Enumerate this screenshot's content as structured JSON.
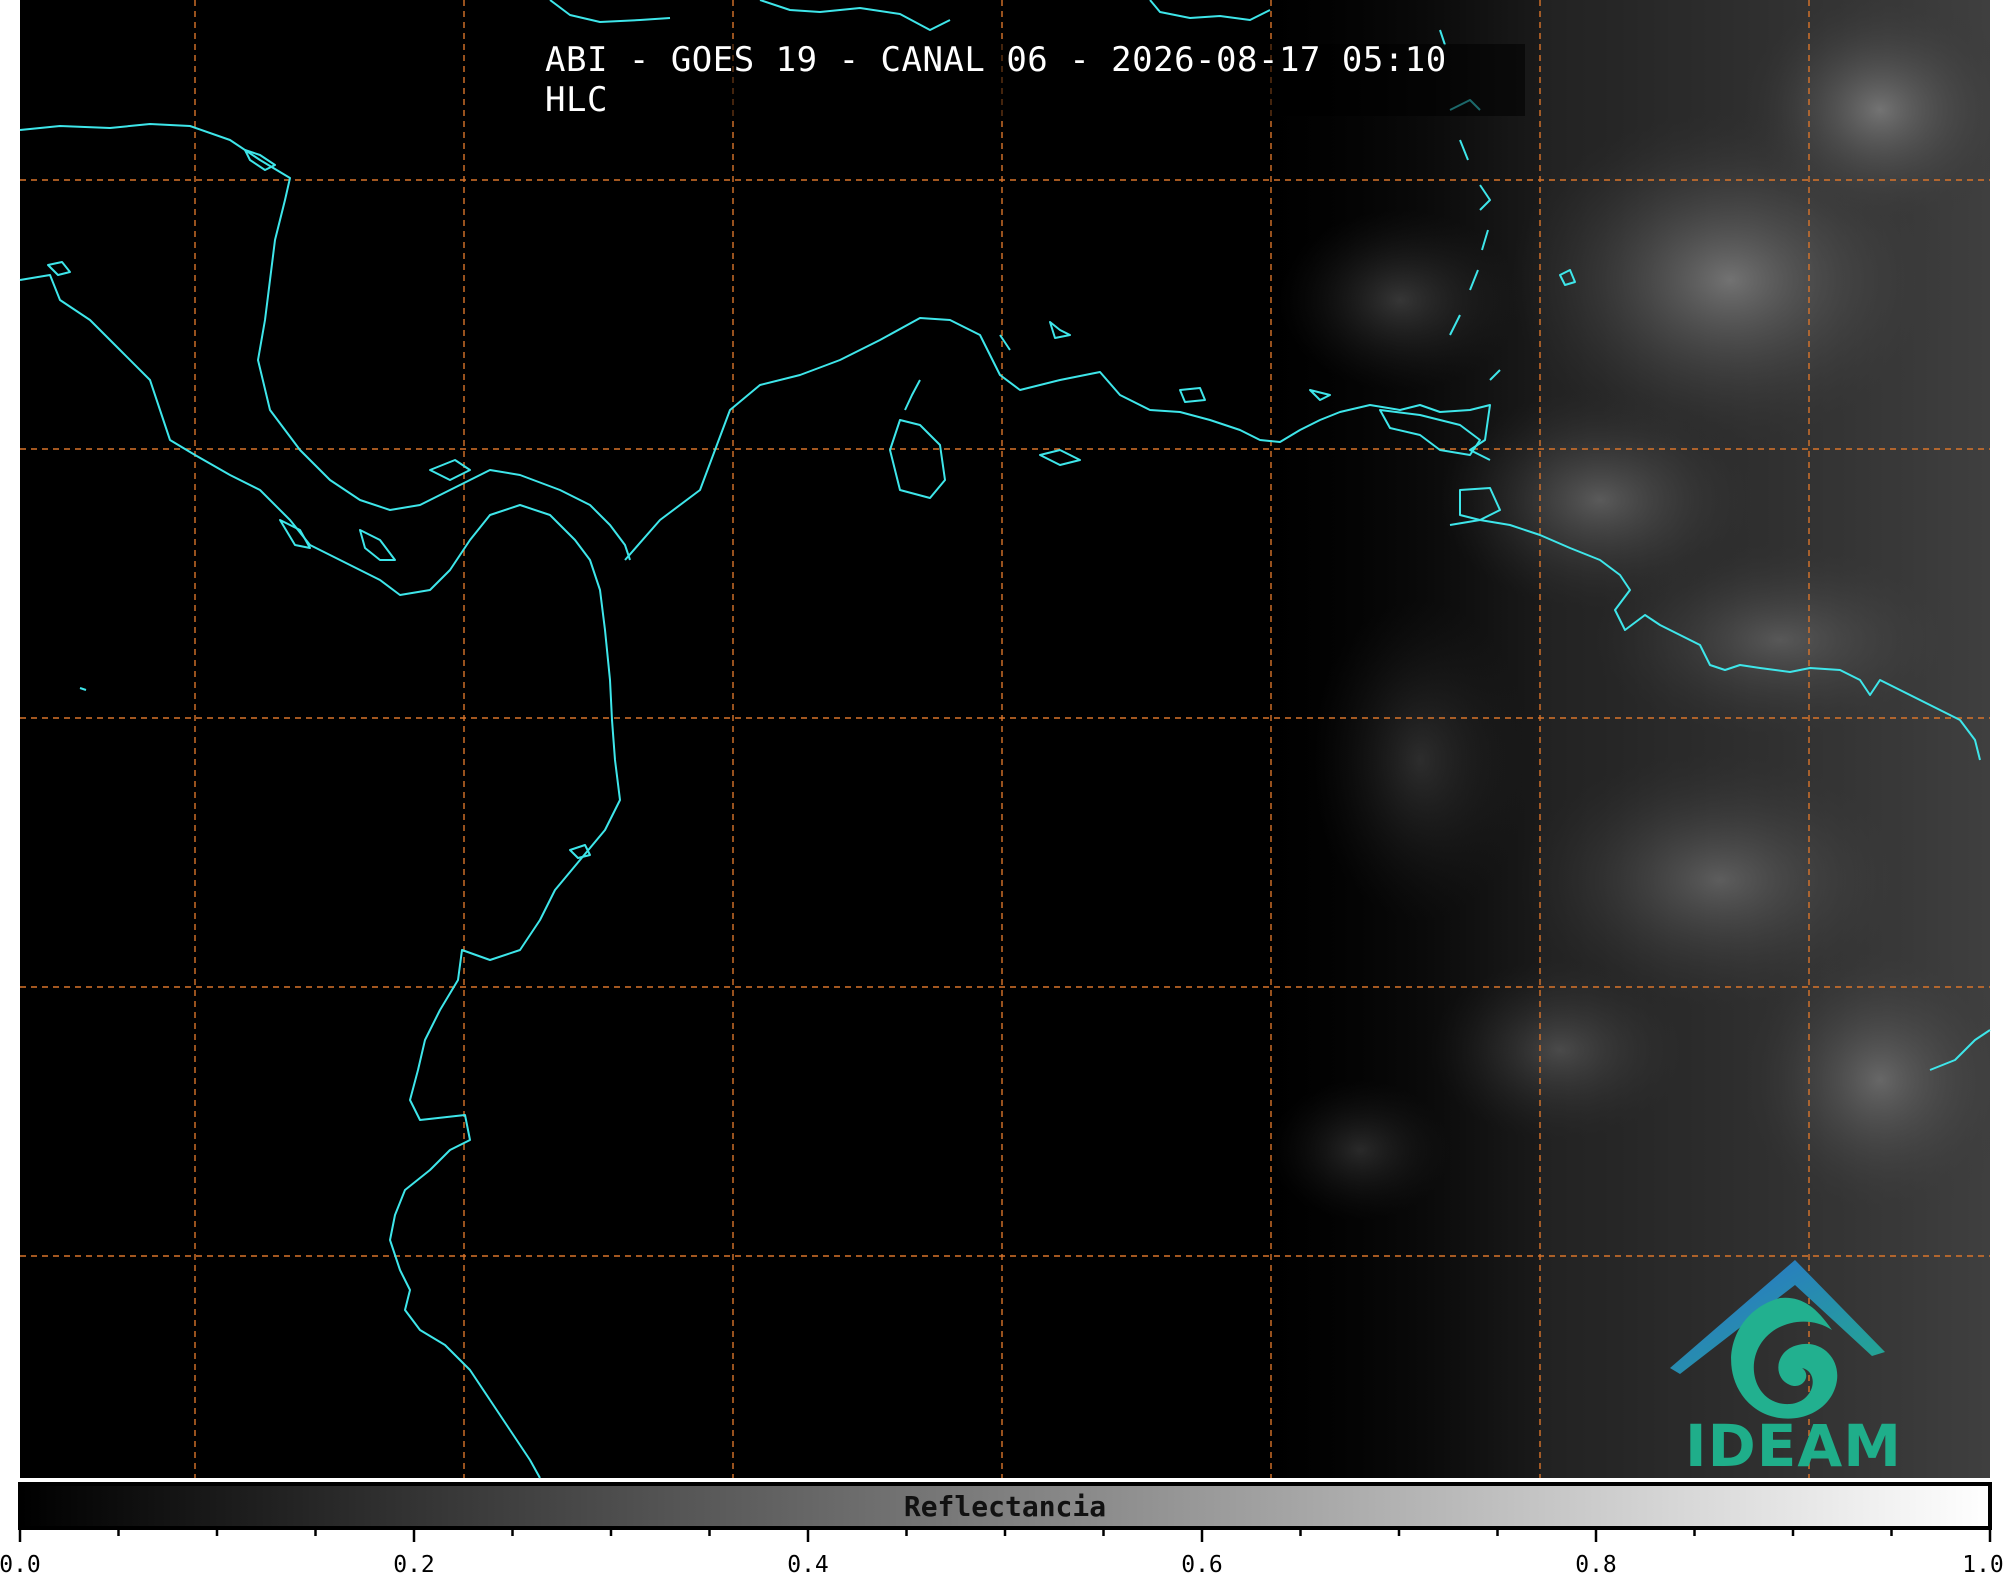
{
  "title": "ABI - GOES 19 - CANAL 06 - 2026-08-17 05:10 HLC",
  "colorbar": {
    "label": "Reflectancia",
    "min": 0.0,
    "max": 1.0,
    "tick_labels": [
      "0.0",
      "0.2",
      "0.4",
      "0.6",
      "0.8",
      "1.0"
    ],
    "minor_tick_count": 20,
    "colormap": [
      "#000000",
      "#ffffff"
    ]
  },
  "map": {
    "background": "#000000",
    "coastline_color": "#3ee6ea",
    "grid_color": "#d9742a",
    "grid_style": "dashed"
  },
  "logo": {
    "text": "IDEAM",
    "roof_color": "#2e7fc4",
    "swirl_color": "#22b08f",
    "text_color": "#1fae8a"
  }
}
